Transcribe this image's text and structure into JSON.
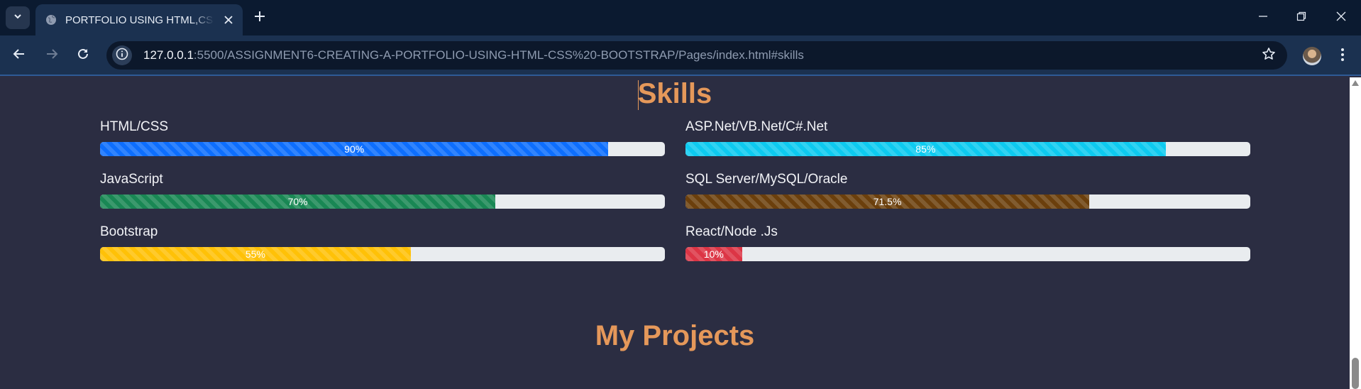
{
  "browser": {
    "tab_title": "PORTFOLIO USING HTML,CSS & BOOTSTRAP",
    "url_host": "127.0.0.1",
    "url_rest": ":5500/ASSIGNMENT6-CREATING-A-PORTFOLIO-USING-HTML-CSS%20-BOOTSTRAP/Pages/index.html#skills",
    "icons": [
      "chevron-down-icon",
      "globe-icon",
      "close-icon",
      "plus-icon",
      "minimize-icon",
      "restore-icon",
      "close-window-icon",
      "back-arrow-icon",
      "forward-arrow-icon",
      "reload-icon",
      "info-icon",
      "star-icon",
      "avatar",
      "kebab-menu-icon"
    ]
  },
  "page": {
    "skills_heading": "Skills",
    "projects_heading": "My Projects",
    "heading_color": "#e5985a",
    "background_color": "#2b2d42"
  },
  "skills": [
    {
      "name": "HTML/CSS",
      "percent": 90,
      "label": "90%",
      "color": "#0d6efd"
    },
    {
      "name": "ASP.Net/VB.Net/C#.Net",
      "percent": 85,
      "label": "85%",
      "color": "#0dcaf0"
    },
    {
      "name": "JavaScript",
      "percent": 70,
      "label": "70%",
      "color": "#198754"
    },
    {
      "name": "SQL Server/MySQL/Oracle",
      "percent": 71.5,
      "label": "71.5%",
      "color": "#6b3f0c"
    },
    {
      "name": "Bootstrap",
      "percent": 55,
      "label": "55%",
      "color": "#ffc107"
    },
    {
      "name": "React/Node .Js",
      "percent": 10,
      "label": "10%",
      "color": "#dc3545"
    }
  ]
}
